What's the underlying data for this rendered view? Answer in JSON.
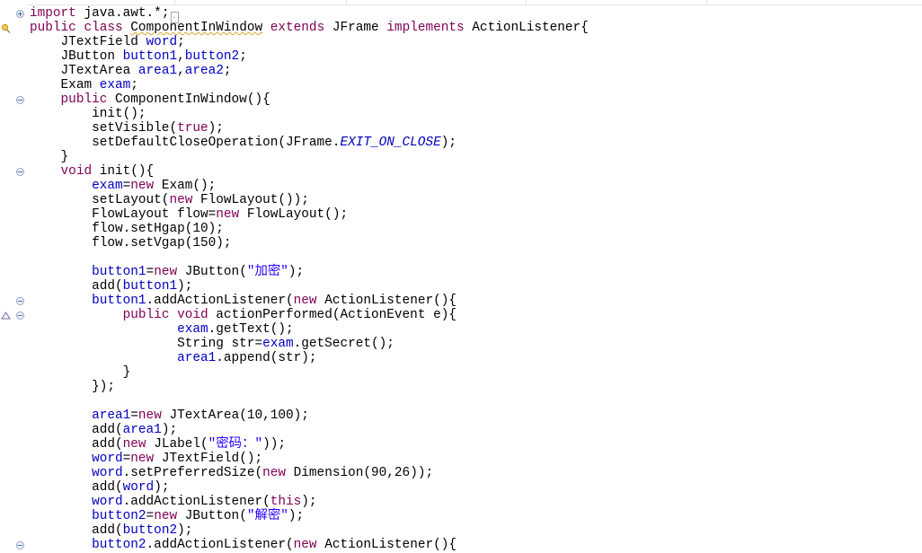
{
  "editor": {
    "language": "java",
    "collapsed_marker": "..",
    "lines": [
      [
        {
          "t": "import",
          "c": "kw"
        },
        {
          "t": " java.awt.*;"
        }
      ],
      [
        {
          "t": "public",
          "c": "kw"
        },
        {
          "t": " "
        },
        {
          "t": "class",
          "c": "kw"
        },
        {
          "t": " "
        },
        {
          "t": "ComponentInWindow",
          "c": "ref-squiggle"
        },
        {
          "t": " "
        },
        {
          "t": "extends",
          "c": "kw"
        },
        {
          "t": " JFrame "
        },
        {
          "t": "implements",
          "c": "kw"
        },
        {
          "t": " ActionListener{"
        }
      ],
      [
        {
          "t": "    JTextField "
        },
        {
          "t": "word",
          "c": "fld"
        },
        {
          "t": ";"
        }
      ],
      [
        {
          "t": "    JButton "
        },
        {
          "t": "button1",
          "c": "fld"
        },
        {
          "t": ","
        },
        {
          "t": "button2",
          "c": "fld"
        },
        {
          "t": ";"
        }
      ],
      [
        {
          "t": "    JTextArea "
        },
        {
          "t": "area1",
          "c": "fld"
        },
        {
          "t": ","
        },
        {
          "t": "area2",
          "c": "fld"
        },
        {
          "t": ";"
        }
      ],
      [
        {
          "t": "    Exam "
        },
        {
          "t": "exam",
          "c": "fld"
        },
        {
          "t": ";"
        }
      ],
      [
        {
          "t": "    "
        },
        {
          "t": "public",
          "c": "kw"
        },
        {
          "t": " ComponentInWindow(){"
        }
      ],
      [
        {
          "t": "        init();"
        }
      ],
      [
        {
          "t": "        setVisible("
        },
        {
          "t": "true",
          "c": "kw"
        },
        {
          "t": ");"
        }
      ],
      [
        {
          "t": "        setDefaultCloseOperation(JFrame."
        },
        {
          "t": "EXIT_ON_CLOSE",
          "c": "const"
        },
        {
          "t": ");"
        }
      ],
      [
        {
          "t": "    }"
        }
      ],
      [
        {
          "t": "    "
        },
        {
          "t": "void",
          "c": "kw"
        },
        {
          "t": " init(){"
        }
      ],
      [
        {
          "t": "        "
        },
        {
          "t": "exam",
          "c": "fld"
        },
        {
          "t": "="
        },
        {
          "t": "new",
          "c": "kw"
        },
        {
          "t": " Exam();"
        }
      ],
      [
        {
          "t": "        setLayout("
        },
        {
          "t": "new",
          "c": "kw"
        },
        {
          "t": " FlowLayout());"
        }
      ],
      [
        {
          "t": "        FlowLayout flow="
        },
        {
          "t": "new",
          "c": "kw"
        },
        {
          "t": " FlowLayout();"
        }
      ],
      [
        {
          "t": "        flow.setHgap(10);"
        }
      ],
      [
        {
          "t": "        flow.setVgap(150);"
        }
      ],
      [
        {
          "t": ""
        }
      ],
      [
        {
          "t": "        "
        },
        {
          "t": "button1",
          "c": "fld"
        },
        {
          "t": "="
        },
        {
          "t": "new",
          "c": "kw"
        },
        {
          "t": " JButton("
        },
        {
          "t": "\"加密\"",
          "c": "str"
        },
        {
          "t": ");"
        }
      ],
      [
        {
          "t": "        add("
        },
        {
          "t": "button1",
          "c": "fld"
        },
        {
          "t": ");"
        }
      ],
      [
        {
          "t": "        "
        },
        {
          "t": "button1",
          "c": "fld"
        },
        {
          "t": ".addActionListener("
        },
        {
          "t": "new",
          "c": "kw"
        },
        {
          "t": " ActionListener(){"
        }
      ],
      [
        {
          "t": "            "
        },
        {
          "t": "public",
          "c": "kw"
        },
        {
          "t": " "
        },
        {
          "t": "void",
          "c": "kw"
        },
        {
          "t": " actionPerformed(ActionEvent e){"
        }
      ],
      [
        {
          "t": "                   "
        },
        {
          "t": "exam",
          "c": "fld"
        },
        {
          "t": ".getText();"
        }
      ],
      [
        {
          "t": "                   String str="
        },
        {
          "t": "exam",
          "c": "fld"
        },
        {
          "t": ".getSecret();"
        }
      ],
      [
        {
          "t": "                   "
        },
        {
          "t": "area1",
          "c": "fld"
        },
        {
          "t": ".append(str);"
        }
      ],
      [
        {
          "t": "            }"
        }
      ],
      [
        {
          "t": "        });"
        }
      ],
      [
        {
          "t": ""
        }
      ],
      [
        {
          "t": "        "
        },
        {
          "t": "area1",
          "c": "fld"
        },
        {
          "t": "="
        },
        {
          "t": "new",
          "c": "kw"
        },
        {
          "t": " JTextArea(10,100);"
        }
      ],
      [
        {
          "t": "        add("
        },
        {
          "t": "area1",
          "c": "fld"
        },
        {
          "t": ");"
        }
      ],
      [
        {
          "t": "        add("
        },
        {
          "t": "new",
          "c": "kw"
        },
        {
          "t": " JLabel("
        },
        {
          "t": "\"密码：\"",
          "c": "str"
        },
        {
          "t": "));"
        }
      ],
      [
        {
          "t": "        "
        },
        {
          "t": "word",
          "c": "fld"
        },
        {
          "t": "="
        },
        {
          "t": "new",
          "c": "kw"
        },
        {
          "t": " JTextField();"
        }
      ],
      [
        {
          "t": "        "
        },
        {
          "t": "word",
          "c": "fld"
        },
        {
          "t": ".setPreferredSize("
        },
        {
          "t": "new",
          "c": "kw"
        },
        {
          "t": " Dimension(90,26));"
        }
      ],
      [
        {
          "t": "        add("
        },
        {
          "t": "word",
          "c": "fld"
        },
        {
          "t": ");"
        }
      ],
      [
        {
          "t": "        "
        },
        {
          "t": "word",
          "c": "fld"
        },
        {
          "t": ".addActionListener("
        },
        {
          "t": "this",
          "c": "kw"
        },
        {
          "t": ");"
        }
      ],
      [
        {
          "t": "        "
        },
        {
          "t": "button2",
          "c": "fld"
        },
        {
          "t": "="
        },
        {
          "t": "new",
          "c": "kw"
        },
        {
          "t": " JButton("
        },
        {
          "t": "\"解密\"",
          "c": "str"
        },
        {
          "t": ");"
        }
      ],
      [
        {
          "t": "        add("
        },
        {
          "t": "button2",
          "c": "fld"
        },
        {
          "t": ");"
        }
      ],
      [
        {
          "t": "        "
        },
        {
          "t": "button2",
          "c": "fld"
        },
        {
          "t": ".addActionListener("
        },
        {
          "t": "new",
          "c": "kw"
        },
        {
          "t": " ActionListener(){"
        }
      ]
    ],
    "fold_markers": [
      {
        "line": 0,
        "kind": "expand"
      },
      {
        "line": 6,
        "kind": "collapse"
      },
      {
        "line": 11,
        "kind": "collapse"
      },
      {
        "line": 20,
        "kind": "collapse"
      },
      {
        "line": 21,
        "kind": "collapse"
      },
      {
        "line": 37,
        "kind": "collapse"
      }
    ],
    "gutter_markers": [
      {
        "line": 1,
        "icon": "warning-icon"
      },
      {
        "line": 21,
        "icon": "override-icon"
      }
    ]
  },
  "colors": {
    "keyword": "#7f0055",
    "field": "#0000c0",
    "string": "#2a00ff",
    "constant": "#0000c0",
    "text": "#000000"
  }
}
